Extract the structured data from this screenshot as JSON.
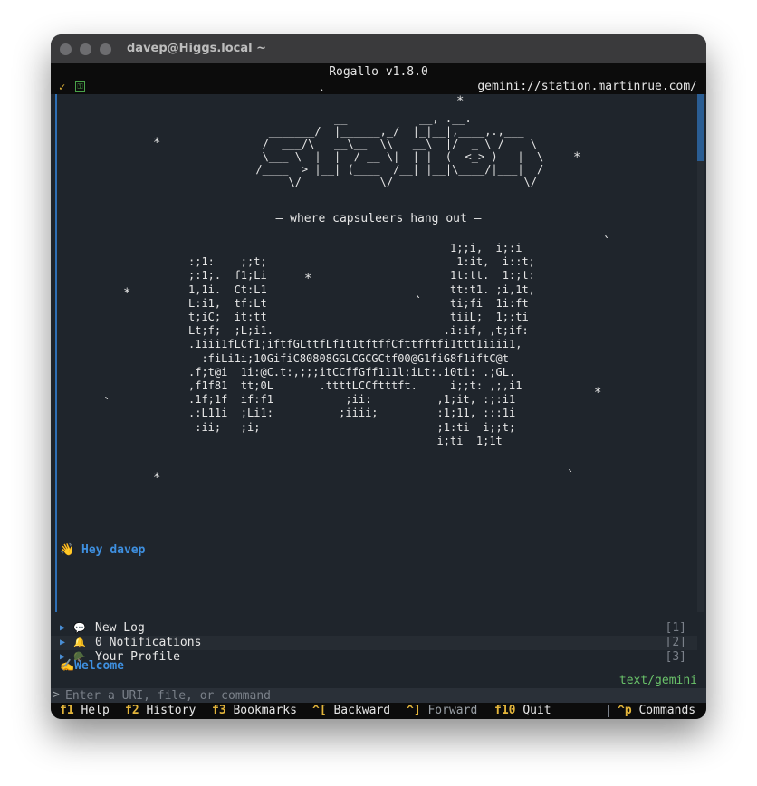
{
  "window": {
    "title": "davep@Higgs.local ~"
  },
  "app": {
    "title": "Rogallo v1.8.0",
    "url": "gemini://station.martinrue.com/"
  },
  "art": {
    "logo": "                  __           __, .__.\n        _______/  |______,_/  |_|__|,____,.,___\n       /  ___/\\   __\\__  \\\\   __\\  |/  _ \\ /    \\\n       \\___ \\  |  |  / __ \\|  | |  (  <_> )   |  \\\n      /____  > |__| (____  /__| |__|\\____/|___|  /\n           \\/            \\/                    \\/",
    "tagline": "— where capsuleers hang out —",
    "ships": "                                        1;;i,  i;:i\n:;1:    ;;t;                             1:it,  i::t;\n;:1;.  f1;Li                            1t:tt.  1:;t:\n1,1i.  Ct:L1                            tt:t1. ;i,1t,\nL:i1,  tf:Lt                            ti;fi  1i:ft\nt;iC;  it:tt                            tiiL;  1;:ti\nLt;f;  ;L;i1.                          .i:if, ,t;if:\n.1iii1fLCf1;iftfGLttfLf1t1tftffCfttfftfi1ttt1iiii1,\n  :fiLi1i;10GifiC80808GGLCGCGCtf00@G1fiG8f1iftC@t\n.f;t@i  1i:@C.t:,;;;itCCffGff111l:iLt:.i0ti: .;GL.\n,f1f81  tt;0L       .ttttLCCftttft.     i;;t: ,;,i1\n.1f;1f  if:f1           ;ii:          ,1;it, :;:i1\n.:L11i  ;Li1:          ;iiii;         :1;11, :::1i\n :ii;   ;i;                           ;1:ti  i;;t;\n                                      i;ti  1;1t"
  },
  "greeting": "👋 Hey davep",
  "menu": [
    {
      "icon": "💬",
      "label": "New Log",
      "key": "[1]"
    },
    {
      "icon": "🔔",
      "label": "0 Notifications",
      "key": "[2]"
    },
    {
      "icon": "🪖",
      "label": "Your Profile",
      "key": "[3]"
    }
  ],
  "welcome": "✍️Welcome",
  "mime": "text/gemini",
  "input": {
    "prompt": ">",
    "placeholder": "Enter a URI, file, or command"
  },
  "footer": {
    "help": {
      "key": "f1",
      "label": "Help"
    },
    "history": {
      "key": "f2",
      "label": "History"
    },
    "bookmarks": {
      "key": "f3",
      "label": "Bookmarks"
    },
    "backward": {
      "key": "^[",
      "label": "Backward"
    },
    "forward": {
      "key": "^]",
      "label": "Forward"
    },
    "quit": {
      "key": "f10",
      "label": "Quit"
    },
    "commands": {
      "key": "^p",
      "label": "Commands"
    }
  },
  "colors": {
    "accent": "#e2b43a",
    "link": "#3e8fdf",
    "mime": "#6ac26a",
    "background": "#1f252c"
  }
}
